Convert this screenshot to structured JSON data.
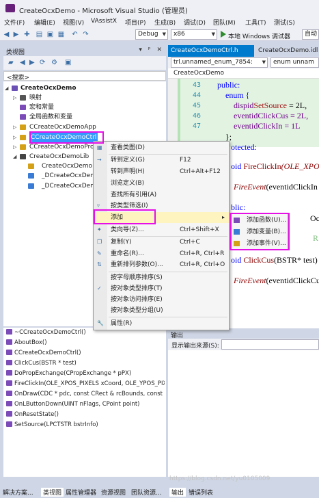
{
  "titlebar": {
    "title": "CreateOcxDemo - Microsoft Visual Studio (管理员)"
  },
  "menu": [
    "文件(F)",
    "编辑(E)",
    "视图(V)",
    "VAssistX",
    "项目(P)",
    "生成(B)",
    "调试(D)",
    "团队(M)",
    "工具(T)",
    "测试(S)"
  ],
  "toolbar": {
    "config": "Debug",
    "platform": "x86",
    "run_label": "本地 Windows 调试器",
    "auto_label": "自动"
  },
  "classview": {
    "title": "类视图",
    "pin": "▾ ᵖ ✕",
    "search_placeholder": "<搜索>",
    "tree": [
      {
        "label": "CreateOcxDemo"
      },
      {
        "label": "映射"
      },
      {
        "label": "宏和常量"
      },
      {
        "label": "全局函数和变量"
      },
      {
        "label": "CCreateOcxDemoApp"
      },
      {
        "label": "CCreateOcxDemoCtrl"
      },
      {
        "label": "CCreateOcxDemoPro"
      },
      {
        "label": "CreateOcxDemoLib"
      },
      {
        "label": "CreateOcxDemo"
      },
      {
        "label": "_DCreateOcxDem"
      },
      {
        "label": "_DCreateOcxDem"
      }
    ],
    "members": [
      "~CCreateOcxDemoCtrl()",
      "AboutBox()",
      "CCreateOcxDemoCtrl()",
      "ClickCus(BSTR * test)",
      "DoPropExchange(CPropExchange * pPX)",
      "FireClickIn(OLE_XPOS_PIXELS xCoord, OLE_YPOS_PIXELS",
      "OnDraw(CDC * pdc, const CRect & rcBounds, const",
      "OnLButtonDown(UINT nFlags, CPoint point)",
      "OnResetState()",
      "SetSource(LPCTSTR bstrInfo)"
    ]
  },
  "context_menu": {
    "items": [
      {
        "label": "查看类图(D)",
        "shortcut": ""
      },
      {
        "label": "转到定义(G)",
        "shortcut": "F12"
      },
      {
        "label": "转到声明(H)",
        "shortcut": "Ctrl+Alt+F12"
      },
      {
        "label": "浏览定义(B)",
        "shortcut": ""
      },
      {
        "label": "查找所有引用(A)",
        "shortcut": ""
      },
      {
        "label": "按类型筛选(I)",
        "shortcut": ""
      },
      {
        "label": "添加",
        "shortcut": ""
      },
      {
        "label": "类向导(Z)...",
        "shortcut": "Ctrl+Shift+X"
      },
      {
        "label": "复制(Y)",
        "shortcut": "Ctrl+C"
      },
      {
        "label": "重命名(R)...",
        "shortcut": "Ctrl+R, Ctrl+R"
      },
      {
        "label": "重新排列参数(O)...",
        "shortcut": "Ctrl+R, Ctrl+O"
      },
      {
        "label": "按字母顺序排序(S)",
        "shortcut": ""
      },
      {
        "label": "按对象类型排序(T)",
        "shortcut": ""
      },
      {
        "label": "按对象访问排序(E)",
        "shortcut": ""
      },
      {
        "label": "按对象类型分组(U)",
        "shortcut": ""
      },
      {
        "label": "属性(R)",
        "shortcut": ""
      }
    ],
    "submenu_arrow": "▸"
  },
  "submenu": {
    "items": [
      "添加函数(U)...",
      "添加变量(B)...",
      "添加事件(V)..."
    ]
  },
  "editor": {
    "tabs": [
      "CreateOcxDemoCtrl.h",
      "CreateOcxDemo.idl"
    ],
    "nav_left": "trl.unnamed_enum_7854:",
    "nav_right": "enum unnam",
    "nav2": "CreateOcxDemo",
    "line_numbers": [
      "43",
      "44",
      "45",
      "46",
      "47"
    ],
    "code_lines": {
      "public1": "public:",
      "enum": "enum {",
      "l45a": "dispid",
      "l45b": "SetSource",
      "l45c": " = 2L,",
      "l46": "eventidClickCus = 2L,",
      "l47": "eventidClickIn = 1L",
      "close": "};",
      "protected": "otected:",
      "void1a": "oid ",
      "void1b": "FireClickIn",
      "void1c": "(OLE_XPO",
      "fire1a": "FireEvent",
      "fire1b": "(eventidClickIn",
      "public2": "blic:",
      "oc": "Oc",
      "fr": "R",
      "void2a": "oid ",
      "void2b": "ClickCus",
      "void2c": "(BSTR* test)",
      "fire2a": "FireEvent",
      "fire2b": "(eventidClickCu"
    }
  },
  "output": {
    "title": "输出",
    "source_label": "显示输出来源(S):"
  },
  "bottom_tabs_left": [
    "解决方案...",
    "类视图",
    "属性管理器",
    "资源视图",
    "团队资源..."
  ],
  "bottom_tabs_right": [
    "输出",
    "错误列表"
  ],
  "watermark": "https://blog.csdn.net/yu0105009"
}
